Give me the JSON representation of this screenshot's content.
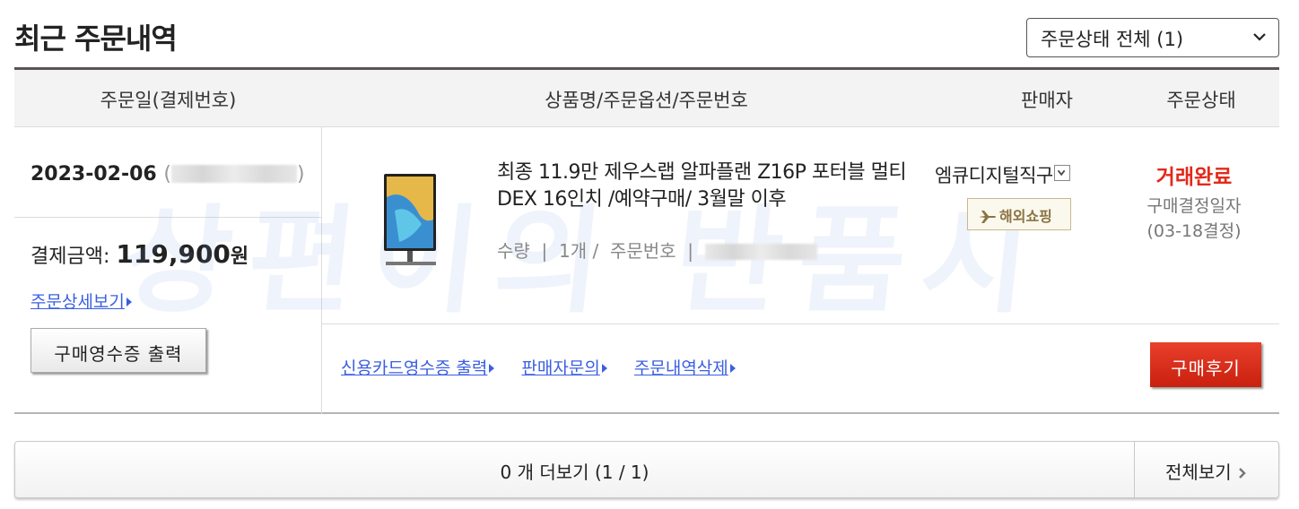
{
  "page": {
    "title": "최근 주문내역"
  },
  "filter": {
    "selected": "주문상태 전체 (1)"
  },
  "table": {
    "headers": {
      "date": "주문일(결제번호)",
      "product": "상품명/주문옵션/주문번호",
      "seller": "판매자",
      "status": "주문상태"
    }
  },
  "order": {
    "date": "2023-02-06",
    "paren_open": "(",
    "paren_close": ")",
    "payment_label": "결제금액:",
    "payment_amount": "119,900",
    "payment_unit": "원",
    "detail_link": "주문상세보기",
    "receipt_button": "구매영수증 출력",
    "product_name": "최종 11.9만 제우스랩 알파플랜 Z16P 포터블 멀티 DEX 16인치 /예약구매/ 3월말 이후",
    "qty_label": "수량",
    "qty_value": "1개 /",
    "order_no_label": "주문번호",
    "separator": "|",
    "seller_name": "엠큐디지털직구",
    "overseas_badge": "해외쇼핑",
    "status": "거래완료",
    "status_sub_1": "구매결정일자",
    "status_sub_2": "(03-18결정)",
    "links": {
      "card_receipt": "신용카드영수증 출력",
      "seller_inquiry": "판매자문의",
      "delete_order": "주문내역삭제"
    },
    "review_button": "구매후기"
  },
  "footer": {
    "more_text": "0 개 더보기 (1 / 1)",
    "view_all": "전체보기"
  },
  "watermark": "상편이의 반품시",
  "colors": {
    "status_red": "#e3291a",
    "link_blue": "#3b5fe0",
    "header_border": "#5a5352",
    "review_button": "#d9301b"
  }
}
